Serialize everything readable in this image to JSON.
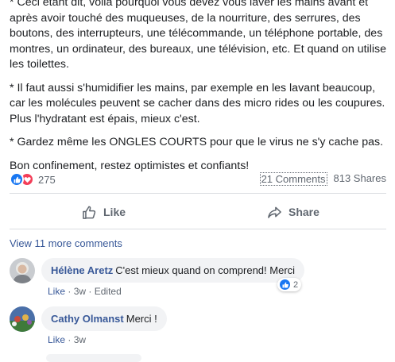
{
  "post": {
    "paragraphs": [
      "* Ceci étant dit, voilà pourquoi vous devez vous laver les mains avant et après avoir touché des muqueuses, de la nourriture, des serrures, des boutons, des interrupteurs, une télécommande, un téléphone portable, des montres, un ordinateur, des bureaux, une télévision, etc. Et quand on utilise les toilettes.",
      "* Il faut aussi s'humidifier les mains, par exemple en les lavant beaucoup, car les molécules peuvent se cacher dans des micro rides ou les coupures. Plus l'hydratant est épais, mieux c'est.",
      "* Gardez même les ONGLES COURTS pour que le virus ne s'y cache pas.",
      "Bon confinement, restez optimistes et confiants!"
    ]
  },
  "stats": {
    "reaction_count": "275",
    "comments": "21 Comments",
    "shares": "813 Shares"
  },
  "actions": {
    "like": "Like",
    "share": "Share"
  },
  "view_more": "View 11 more comments",
  "comments": [
    {
      "author": "Hélène Aretz",
      "text": "C'est mieux quand on comprend! Merci",
      "like": "Like",
      "sep": "·",
      "time": "3w",
      "sep2": "·",
      "edited": "Edited",
      "reactions": "2"
    },
    {
      "author": "Cathy Olmanst",
      "text": "Merci !",
      "like": "Like",
      "sep": "·",
      "time": "3w"
    }
  ],
  "colors": {
    "accent": "#1877f2",
    "link": "#385898",
    "love": "#f33e58",
    "bubble": "#f2f3f5"
  }
}
